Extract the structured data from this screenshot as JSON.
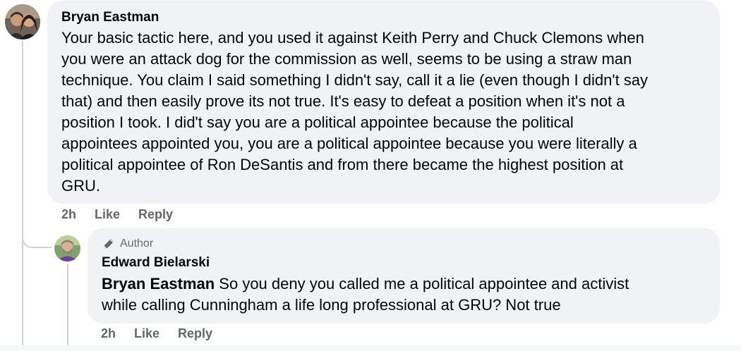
{
  "comment": {
    "author": "Bryan Eastman",
    "text": "Your basic tactic here, and you used it against Keith Perry and Chuck Clemons when\nyou were an attack dog for the commission as well, seems to be using a straw man\ntechnique. You claim I said something I didn't say, call it a lie (even though I didn't say\nthat) and then easily prove its not true. It's easy to defeat a position when it's not a\nposition I took. I did't say you are a political appointee because the political\nappointees appointed you, you are a political appointee because you were literally a\npolitical appointee of Ron DeSantis and from there became the highest position at\nGRU.",
    "time": "2h",
    "like_label": "Like",
    "reply_label": "Reply"
  },
  "reply": {
    "badge": "Author",
    "badge_icon": "pencil-icon",
    "author": "Edward Bielarski",
    "mention": "Bryan Eastman",
    "text": " So you deny you called me a political appointee and activist\nwhile calling Cunningham a life long professional at GRU? Not true",
    "time": "2h",
    "like_label": "Like",
    "reply_label": "Reply"
  },
  "colors": {
    "bubble": "#f0f2f5",
    "meta_text": "#65676b",
    "thread_line": "#ced0d4"
  }
}
